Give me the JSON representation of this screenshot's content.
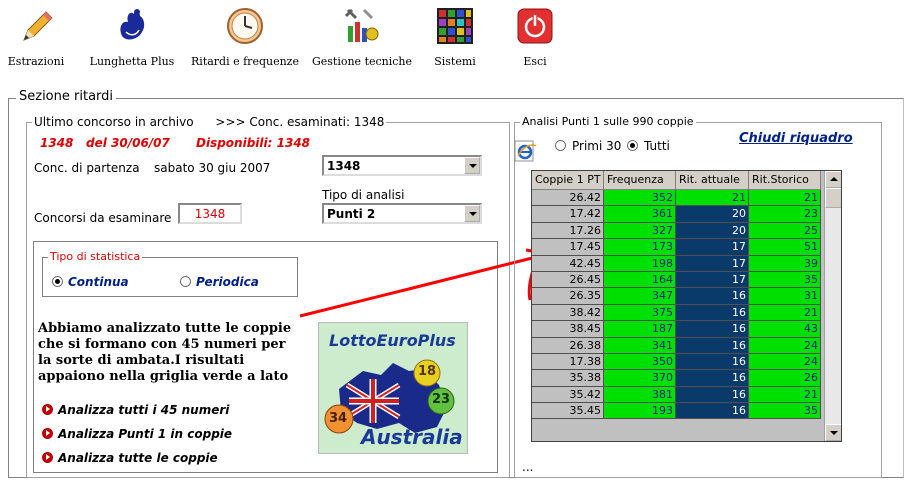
{
  "toolbar": {
    "items": [
      {
        "label": "Estrazioni",
        "icon": "pencil-icon"
      },
      {
        "label": "Lunghetta Plus",
        "icon": "lottery-hand-icon"
      },
      {
        "label": "Ritardi e frequenze",
        "icon": "clock-icon"
      },
      {
        "label": "Gestione tecniche",
        "icon": "tools-icon"
      },
      {
        "label": "Sistemi",
        "icon": "grid-icon"
      },
      {
        "label": "Esci",
        "icon": "power-icon"
      }
    ]
  },
  "section": {
    "title": "Sezione ritardi"
  },
  "left_panel": {
    "legend_left": "Ultimo concorso in archivo",
    "legend_right": ">>> Conc. esaminati: 1348",
    "last_number": "1348",
    "last_date": "del 30/06/07",
    "available": "Disponibili: 1348",
    "start_label": "Conc. di partenza",
    "start_date": "sabato 30 giu 2007",
    "start_combo": "1348",
    "to_examine_label": "Concorsi da esaminare",
    "to_examine_value": "1348",
    "analysis_type_label": "Tipo di analisi",
    "analysis_combo": "Punti 2"
  },
  "stat_type": {
    "legend": "Tipo di statistica",
    "continua": "Continua",
    "periodica": "Periodica"
  },
  "info": {
    "text": "Abbiamo analizzato tutte le coppie che si formano con 45 numeri per la sorte di ambata.I risultati appaiono nella griglia verde a lato"
  },
  "links": [
    "Analizza tutti i 45 numeri",
    "Analizza Punti 1 in coppie",
    "Analizza tutte le coppie"
  ],
  "logo": {
    "brand": "LottoEuroPlus",
    "region": "Australia",
    "balls": [
      "18",
      "23",
      "34"
    ]
  },
  "right_panel": {
    "legend": "Analisi Punti 1 sulle 990 coppie",
    "primi30": "Primi 30",
    "tutti": "Tutti",
    "close_link": "Chiudi riquadro",
    "footer": "..."
  },
  "grid": {
    "headers": [
      "Coppie 1 PT",
      "Frequenza",
      "Rit. attuale",
      "Rit.Storico"
    ],
    "rows": [
      [
        "26.42",
        "352",
        "21",
        "21"
      ],
      [
        "17.42",
        "361",
        "20",
        "23"
      ],
      [
        "17.26",
        "327",
        "20",
        "25"
      ],
      [
        "17.45",
        "173",
        "17",
        "51"
      ],
      [
        "42.45",
        "198",
        "17",
        "39"
      ],
      [
        "26.45",
        "164",
        "17",
        "35"
      ],
      [
        "26.35",
        "347",
        "16",
        "31"
      ],
      [
        "38.42",
        "375",
        "16",
        "21"
      ],
      [
        "38.45",
        "187",
        "16",
        "43"
      ],
      [
        "26.38",
        "341",
        "16",
        "24"
      ],
      [
        "17.38",
        "350",
        "16",
        "24"
      ],
      [
        "35.38",
        "370",
        "16",
        "26"
      ],
      [
        "35.42",
        "381",
        "16",
        "21"
      ],
      [
        "35.45",
        "193",
        "16",
        "35"
      ]
    ]
  },
  "colors": {
    "grid_green": "#00e000",
    "grid_navy": "#0a3a6a",
    "accent_red": "#e00000",
    "link_blue": "#00208a"
  }
}
